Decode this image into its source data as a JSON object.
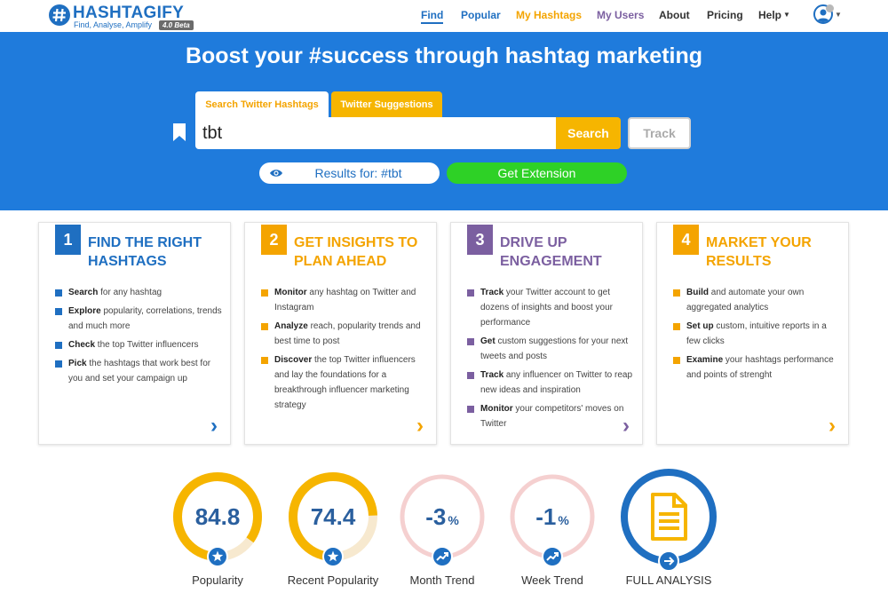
{
  "header": {
    "logo_name": "HASHTAGIFY",
    "logo_tagline": "Find, Analyse, Amplify",
    "logo_badge": "4.0 Beta",
    "nav": {
      "find": "Find",
      "popular": "Popular",
      "my_hashtags": "My Hashtags",
      "my_users": "My Users",
      "about": "About",
      "pricing": "Pricing",
      "help": "Help"
    }
  },
  "hero": {
    "title": "Boost your #success through hashtag marketing",
    "tabs": [
      "Search Twitter Hashtags",
      "Twitter Suggestions"
    ],
    "search_value": "tbt",
    "search_button": "Search",
    "track_button": "Track",
    "results_text": "Results for: #tbt",
    "extension_button": "Get Extension"
  },
  "cards": [
    {
      "number": "1",
      "title_line1": "FIND THE RIGHT",
      "title_line2": "HASHTAGS",
      "color": "#1f6fc1",
      "items": [
        {
          "bold": "Search",
          "text": " for any hashtag"
        },
        {
          "bold": "Explore",
          "text": " popularity, correlations, trends and much more"
        },
        {
          "bold": "Check",
          "text": " the top Twitter influencers"
        },
        {
          "bold": "Pick",
          "text": " the hashtags that work best for you and set your campaign up"
        }
      ]
    },
    {
      "number": "2",
      "title_line1": "GET INSIGHTS TO",
      "title_line2": "PLAN AHEAD",
      "color": "#f4a400",
      "items": [
        {
          "bold": "Monitor",
          "text": " any hashtag on Twitter and Instagram"
        },
        {
          "bold": "Analyze",
          "text": " reach, popularity trends and best time to post"
        },
        {
          "bold": "Discover",
          "text": " the top Twitter influencers and lay the foundations for a breakthrough influencer marketing strategy"
        }
      ]
    },
    {
      "number": "3",
      "title_line1": "DRIVE UP",
      "title_line2": "ENGAGEMENT",
      "color": "#7b5fa0",
      "items": [
        {
          "bold": "Track",
          "text": " your Twitter account to get dozens of insights and boost your performance"
        },
        {
          "bold": "Get",
          "text": " custom suggestions for your next tweets and posts"
        },
        {
          "bold": "Track",
          "text": " any influencer on Twitter to reap new ideas and inspiration"
        },
        {
          "bold": "Monitor",
          "text": " your competitors' moves on Twitter"
        }
      ]
    },
    {
      "number": "4",
      "title_line1": "MARKET YOUR",
      "title_line2": "RESULTS",
      "color": "#f4a400",
      "items": [
        {
          "bold": "Build",
          "text": " and automate your own aggregated analytics"
        },
        {
          "bold": "Set up",
          "text": " custom, intuitive reports in a few clicks"
        },
        {
          "bold": "Examine",
          "text": " your hashtags performance and points of strenght"
        }
      ]
    }
  ],
  "metrics": [
    {
      "value": "84.8",
      "label": "Popularity",
      "level": 84.8,
      "color": "#f6b500",
      "icon": "star-icon"
    },
    {
      "value": "74.4",
      "label": "Recent Popularity",
      "level": 74.4,
      "color": "#f6b500",
      "icon": "star-icon"
    },
    {
      "value": "-3",
      "unit": "%",
      "label": "Month Trend",
      "level": 0,
      "color": "#1f6fc1",
      "icon": "trend-icon"
    },
    {
      "value": "-1",
      "unit": "%",
      "label": "Week Trend",
      "level": 0,
      "color": "#1f6fc1",
      "icon": "trend-icon"
    },
    {
      "label": "FULL ANALYSIS",
      "color": "#1f6fc1",
      "icon": "document-icon"
    }
  ],
  "colors": {
    "brand_blue": "#1f6fc1",
    "hero_blue": "#1f7bdc",
    "accent_yellow": "#f6b500",
    "accent_green": "#2ed126",
    "purple": "#7b5fa0",
    "ring_pink": "#f5d0d0"
  }
}
